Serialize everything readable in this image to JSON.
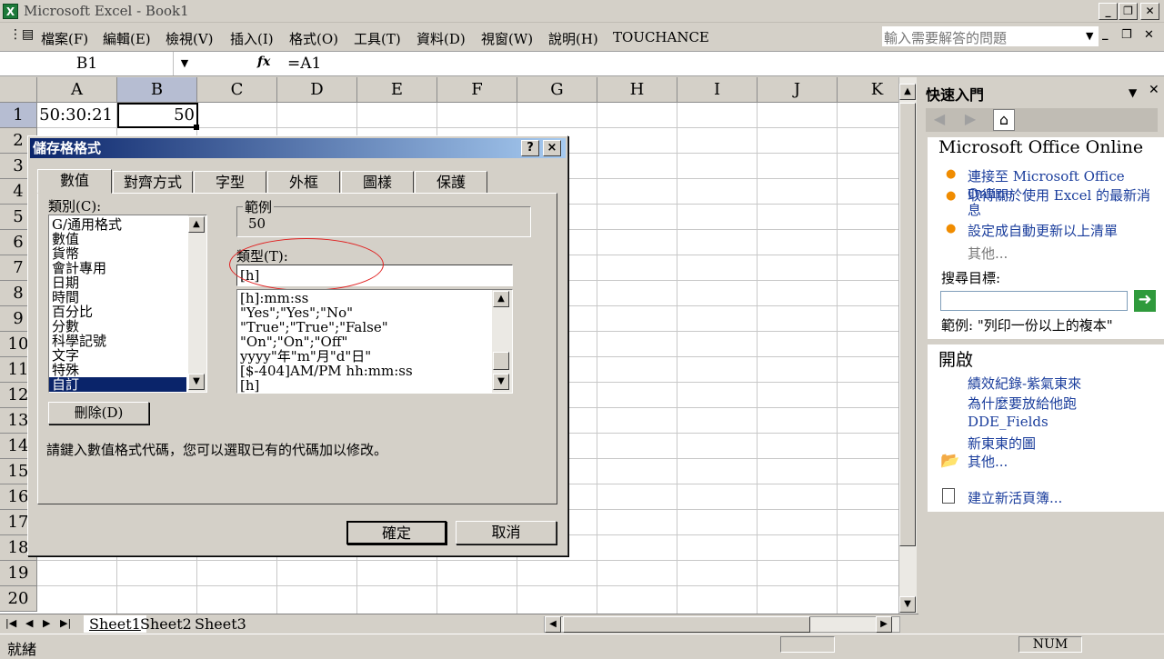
{
  "window": {
    "title": "Microsoft Excel - Book1"
  },
  "menu": {
    "items": [
      "檔案(F)",
      "編輯(E)",
      "檢視(V)",
      "插入(I)",
      "格式(O)",
      "工具(T)",
      "資料(D)",
      "視窗(W)",
      "說明(H)",
      "TOUCHANCE"
    ],
    "help_placeholder": "輸入需要解答的問題"
  },
  "formula": {
    "namebox": "B1",
    "fx": "fx",
    "content": "=A1"
  },
  "sheet": {
    "columns": [
      "A",
      "B",
      "C",
      "D",
      "E",
      "F",
      "G",
      "H",
      "I",
      "J",
      "K"
    ],
    "rows": [
      "1",
      "2",
      "3",
      "4",
      "5",
      "6",
      "7",
      "8",
      "9",
      "10",
      "11",
      "12",
      "13",
      "14",
      "15",
      "16",
      "17",
      "18",
      "19",
      "20"
    ],
    "a1": "50:30:21",
    "b1": "50"
  },
  "tabs": {
    "sheets": [
      "Sheet1",
      "Sheet2",
      "Sheet3"
    ]
  },
  "status": {
    "ready": "就緒",
    "num": "NUM"
  },
  "taskpane": {
    "title": "快速入門",
    "online_heading": "Microsoft Office Online",
    "links": [
      "連接至 Microsoft Office Online",
      "取得關於使用 Excel 的最新消息",
      "設定成自動更新以上清單"
    ],
    "more": "其他...",
    "search_label": "搜尋目標:",
    "search_example": "範例: \"列印一份以上的複本\"",
    "open_heading": "開啟",
    "recent": [
      "績效紀錄-紫氣東來",
      "為什麼要放給他跑",
      "DDE_Fields",
      "新東東的圖"
    ],
    "open_more": "其他...",
    "new_workbook": "建立新活頁簿..."
  },
  "dialog": {
    "title": "儲存格格式",
    "help": "?",
    "close": "×",
    "tabs": [
      "數值",
      "對齊方式",
      "字型",
      "外框",
      "圖樣",
      "保護"
    ],
    "category_label": "類別(C):",
    "categories": [
      "G/通用格式",
      "數值",
      "貨幣",
      "會計專用",
      "日期",
      "時間",
      "百分比",
      "分數",
      "科學記號",
      "文字",
      "特殊",
      "自訂"
    ],
    "sample_label": "範例",
    "sample_value": "50",
    "type_label": "類型(T):",
    "type_value": "[h]",
    "types": [
      "[h]:mm:ss",
      "\"Yes\";\"Yes\";\"No\"",
      "\"True\";\"True\";\"False\"",
      "\"On\";\"On\";\"Off\"",
      "yyyy\"年\"m\"月\"d\"日\"",
      "[$-404]AM/PM hh:mm:ss",
      "[h]"
    ],
    "delete": "刪除(D)",
    "description": "請鍵入數值格式代碼，您可以選取已有的代碼加以修改。",
    "ok": "確定",
    "cancel": "取消"
  },
  "colors": {
    "title_gradient_start": "#0a246a",
    "annotation": "#e02020",
    "link": "#1a3d9c"
  }
}
